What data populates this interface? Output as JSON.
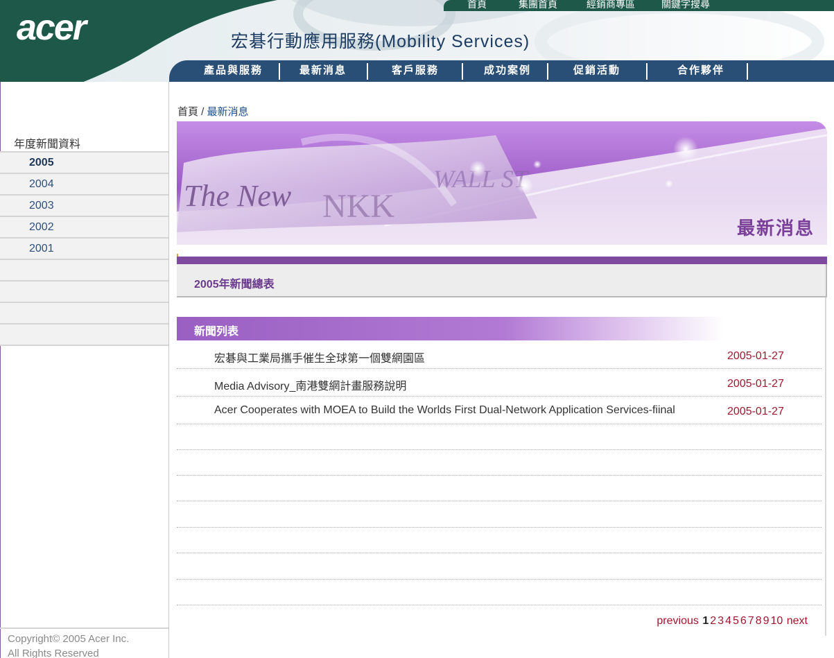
{
  "header": {
    "logo": "acer",
    "site_title": "宏碁行動應用服務(Mobility Services)",
    "top_links": [
      "首頁",
      "集團首頁",
      "經銷商專區",
      "關鍵字搜尋"
    ],
    "main_nav": [
      "產品與服務",
      "最新消息",
      "客戶服務",
      "成功案例",
      "促銷活動",
      "合作夥伴"
    ]
  },
  "breadcrumb": {
    "home": "首頁",
    "separator": " / ",
    "current": "最新消息"
  },
  "banner": {
    "title": "最新消息"
  },
  "sidebar": {
    "heading": "年度新聞資料",
    "years": [
      "2005",
      "2004",
      "2003",
      "2002",
      "2001"
    ],
    "active_year": "2005",
    "copyright_line1": "Copyright© 2005 Acer Inc.",
    "copyright_line2": "All Rights Reserved"
  },
  "section": {
    "year_title": "2005年新聞總表",
    "list_title": "新聞列表"
  },
  "news": [
    {
      "title": "宏碁與工業局攜手催生全球第一個雙網園區",
      "date": "2005-01-27"
    },
    {
      "title": "Media Advisory_南港雙網計畫服務說明",
      "date": "2005-01-27"
    },
    {
      "title": "Acer Cooperates with MOEA to Build the Worlds First Dual-Network Application Services-fiinal",
      "date": "2005-01-27"
    }
  ],
  "pagination": {
    "previous": "previous",
    "pages": [
      "1",
      "2",
      "3",
      "4",
      "5",
      "6",
      "7",
      "8",
      "9",
      "10"
    ],
    "current": "1",
    "next": "next"
  },
  "colors": {
    "header_green": "#1e5848",
    "nav_blue": "#2a4f77",
    "accent_purple": "#7d4a9d",
    "date_red": "#a0172e"
  }
}
